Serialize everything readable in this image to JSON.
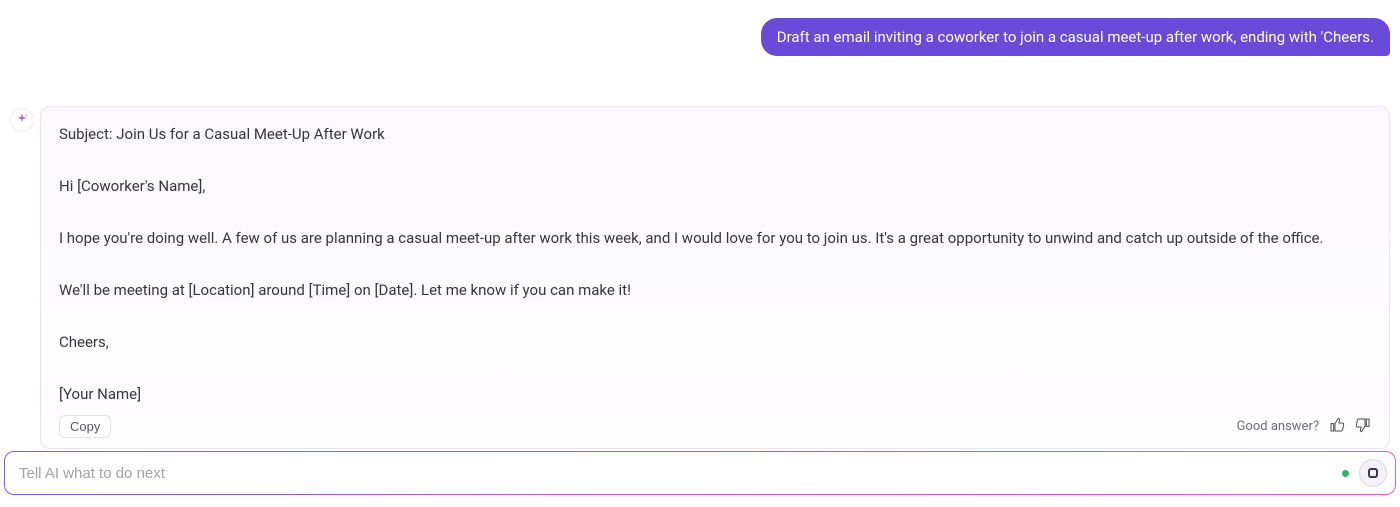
{
  "user": {
    "message": "Draft an email inviting a coworker to join a casual meet-up after work, ending with 'Cheers."
  },
  "assistant": {
    "lines": {
      "subject": "Subject: Join Us for a Casual Meet-Up After Work",
      "greeting": "Hi [Coworker's Name],",
      "body1": "I hope you're doing well. A few of us are planning a casual meet-up after work this week, and I would love for you to join us. It's a great opportunity to unwind and catch up outside of the office.",
      "body2": "We'll be meeting at [Location] around [Time] on [Date]. Let me know if you can make it!",
      "signoff": "Cheers,",
      "signature": "[Your Name]"
    },
    "copy_label": "Copy",
    "feedback_label": "Good answer?"
  },
  "input": {
    "placeholder": "Tell AI what to do next",
    "value": ""
  }
}
